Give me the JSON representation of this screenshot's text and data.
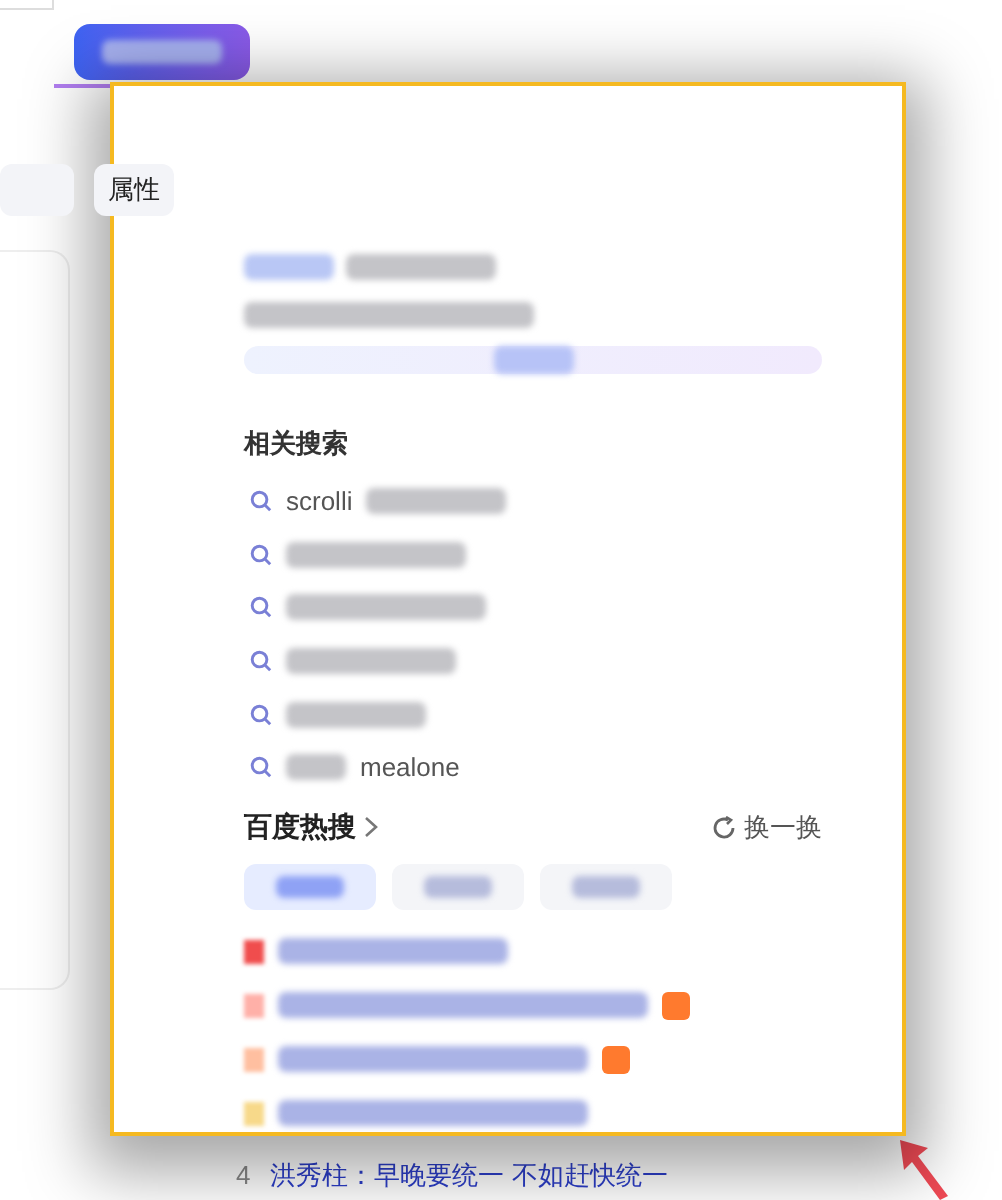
{
  "panel_tabs": [
    {
      "label": "属性",
      "selected": false
    }
  ],
  "popup": {
    "related_title": "相关搜索",
    "related": [
      {
        "kind": "prefix",
        "text": "scrolli"
      },
      {
        "kind": "blurred"
      },
      {
        "kind": "blurred"
      },
      {
        "kind": "blurred"
      },
      {
        "kind": "blurred"
      },
      {
        "kind": "suffix",
        "text": "mealone"
      }
    ],
    "hot_title": "百度热搜",
    "refresh": "换一换",
    "hot_tabs": [
      {
        "selected": true
      },
      {
        "selected": false
      },
      {
        "selected": false
      }
    ],
    "hot_rows": [
      {
        "badge": false
      },
      {
        "badge": true
      },
      {
        "badge": true
      },
      {
        "badge": false
      }
    ]
  },
  "below_row": {
    "rank": "4",
    "text": "洪秀柱：早晚要统一 不如赶快统一"
  }
}
